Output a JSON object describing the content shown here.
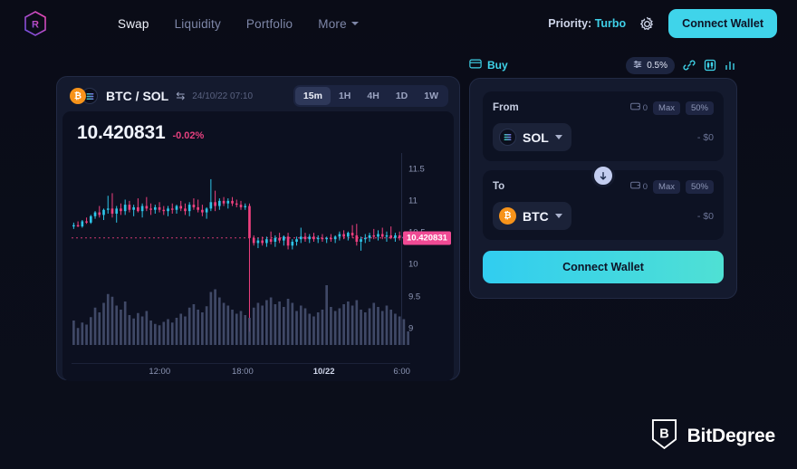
{
  "header": {
    "logo_icon": "raydium-hexagon-logo",
    "nav": [
      {
        "label": "Swap",
        "active": true
      },
      {
        "label": "Liquidity",
        "active": false
      },
      {
        "label": "Portfolio",
        "active": false
      },
      {
        "label": "More",
        "active": false,
        "has_chevron": true
      }
    ],
    "priority_label": "Priority:",
    "priority_value": "Turbo",
    "gear_icon": "gear-icon",
    "connect_wallet": "Connect Wallet",
    "accent_cyan": "#3fd4ea"
  },
  "chart_panel": {
    "base_icon": "btc-coin-icon",
    "quote_icon": "sol-coin-icon",
    "pair": "BTC / SOL",
    "swap_icon": "⇆",
    "timestamp": "24/10/22 07:10",
    "timeframes": [
      {
        "label": "15m",
        "active": true
      },
      {
        "label": "1H",
        "active": false
      },
      {
        "label": "4H",
        "active": false
      },
      {
        "label": "1D",
        "active": false
      },
      {
        "label": "1W",
        "active": false
      }
    ],
    "price": "10.420831",
    "change": "-0.02%",
    "change_color": "#e4407e",
    "price_badge": "10.420831"
  },
  "chart_data": {
    "type": "line",
    "subtype": "candlestick-with-volume",
    "title": "BTC / SOL",
    "xlabel": "",
    "ylabel": "",
    "ylim": [
      8.8,
      11.75
    ],
    "y_ticks": [
      "11.5",
      "11",
      "10.5",
      "10",
      "9.5",
      "9"
    ],
    "y_tick_values": [
      11.5,
      11,
      10.5,
      10,
      9.5,
      9
    ],
    "x_ticks": [
      {
        "label": "12:00",
        "pos": 0.26,
        "bold": false
      },
      {
        "label": "18:00",
        "pos": 0.505,
        "bold": false
      },
      {
        "label": "10/22",
        "pos": 0.745,
        "bold": true
      },
      {
        "label": "6:00",
        "pos": 0.975,
        "bold": false
      }
    ],
    "grid": false,
    "up_color": "#2ec5e8",
    "down_color": "#f0407f",
    "volume_color": "#4a5474",
    "current_price": 10.420831,
    "price_line_value": 10.42,
    "candles": [
      {
        "o": 10.6,
        "h": 10.66,
        "l": 10.56,
        "c": 10.62,
        "v": 0.36
      },
      {
        "o": 10.62,
        "h": 10.68,
        "l": 10.59,
        "c": 10.6,
        "v": 0.25
      },
      {
        "o": 10.6,
        "h": 10.7,
        "l": 10.58,
        "c": 10.68,
        "v": 0.33
      },
      {
        "o": 10.68,
        "h": 10.74,
        "l": 10.64,
        "c": 10.66,
        "v": 0.3
      },
      {
        "o": 10.66,
        "h": 10.78,
        "l": 10.64,
        "c": 10.76,
        "v": 0.41
      },
      {
        "o": 10.76,
        "h": 10.84,
        "l": 10.72,
        "c": 10.82,
        "v": 0.55
      },
      {
        "o": 10.82,
        "h": 10.92,
        "l": 10.74,
        "c": 10.78,
        "v": 0.48
      },
      {
        "o": 10.78,
        "h": 10.88,
        "l": 10.7,
        "c": 10.86,
        "v": 0.62
      },
      {
        "o": 10.86,
        "h": 11.08,
        "l": 10.8,
        "c": 10.88,
        "v": 0.75
      },
      {
        "o": 10.88,
        "h": 11.12,
        "l": 10.74,
        "c": 10.8,
        "v": 0.71
      },
      {
        "o": 10.8,
        "h": 10.92,
        "l": 10.66,
        "c": 10.88,
        "v": 0.58
      },
      {
        "o": 10.88,
        "h": 10.96,
        "l": 10.78,
        "c": 10.84,
        "v": 0.52
      },
      {
        "o": 10.84,
        "h": 11.02,
        "l": 10.78,
        "c": 10.94,
        "v": 0.64
      },
      {
        "o": 10.94,
        "h": 11.0,
        "l": 10.82,
        "c": 10.86,
        "v": 0.44
      },
      {
        "o": 10.86,
        "h": 10.94,
        "l": 10.76,
        "c": 10.9,
        "v": 0.39
      },
      {
        "o": 10.9,
        "h": 11.04,
        "l": 10.82,
        "c": 10.84,
        "v": 0.47
      },
      {
        "o": 10.84,
        "h": 10.96,
        "l": 10.74,
        "c": 10.92,
        "v": 0.42
      },
      {
        "o": 10.92,
        "h": 11.06,
        "l": 10.84,
        "c": 10.88,
        "v": 0.5
      },
      {
        "o": 10.88,
        "h": 10.96,
        "l": 10.78,
        "c": 10.86,
        "v": 0.36
      },
      {
        "o": 10.86,
        "h": 10.94,
        "l": 10.8,
        "c": 10.9,
        "v": 0.31
      },
      {
        "o": 10.9,
        "h": 10.98,
        "l": 10.82,
        "c": 10.86,
        "v": 0.29
      },
      {
        "o": 10.86,
        "h": 10.92,
        "l": 10.78,
        "c": 10.84,
        "v": 0.34
      },
      {
        "o": 10.84,
        "h": 10.92,
        "l": 10.76,
        "c": 10.88,
        "v": 0.38
      },
      {
        "o": 10.88,
        "h": 10.96,
        "l": 10.8,
        "c": 10.86,
        "v": 0.33
      },
      {
        "o": 10.86,
        "h": 10.94,
        "l": 10.8,
        "c": 10.92,
        "v": 0.4
      },
      {
        "o": 10.92,
        "h": 11.0,
        "l": 10.84,
        "c": 10.88,
        "v": 0.46
      },
      {
        "o": 10.88,
        "h": 10.96,
        "l": 10.78,
        "c": 10.84,
        "v": 0.42
      },
      {
        "o": 10.84,
        "h": 10.98,
        "l": 10.76,
        "c": 10.94,
        "v": 0.55
      },
      {
        "o": 10.94,
        "h": 11.04,
        "l": 10.86,
        "c": 10.9,
        "v": 0.6
      },
      {
        "o": 10.9,
        "h": 11.02,
        "l": 10.82,
        "c": 10.86,
        "v": 0.52
      },
      {
        "o": 10.86,
        "h": 10.94,
        "l": 10.76,
        "c": 10.82,
        "v": 0.48
      },
      {
        "o": 10.82,
        "h": 10.9,
        "l": 10.72,
        "c": 10.88,
        "v": 0.57
      },
      {
        "o": 10.88,
        "h": 11.34,
        "l": 10.84,
        "c": 10.98,
        "v": 0.78
      },
      {
        "o": 10.98,
        "h": 11.16,
        "l": 10.84,
        "c": 10.92,
        "v": 0.82
      },
      {
        "o": 10.92,
        "h": 11.04,
        "l": 10.86,
        "c": 11.0,
        "v": 0.7
      },
      {
        "o": 11.0,
        "h": 11.06,
        "l": 10.92,
        "c": 10.96,
        "v": 0.62
      },
      {
        "o": 10.96,
        "h": 11.04,
        "l": 10.88,
        "c": 11.0,
        "v": 0.58
      },
      {
        "o": 11.0,
        "h": 11.06,
        "l": 10.92,
        "c": 10.96,
        "v": 0.52
      },
      {
        "o": 10.96,
        "h": 11.02,
        "l": 10.9,
        "c": 10.94,
        "v": 0.46
      },
      {
        "o": 10.94,
        "h": 11.0,
        "l": 10.86,
        "c": 10.9,
        "v": 0.5
      },
      {
        "o": 10.9,
        "h": 10.96,
        "l": 10.86,
        "c": 10.92,
        "v": 0.44
      },
      {
        "o": 10.92,
        "h": 10.96,
        "l": 8.95,
        "c": 10.42,
        "v": 0.4
      },
      {
        "o": 10.42,
        "h": 10.46,
        "l": 10.3,
        "c": 10.34,
        "v": 0.55
      },
      {
        "o": 10.34,
        "h": 10.42,
        "l": 10.26,
        "c": 10.38,
        "v": 0.62
      },
      {
        "o": 10.38,
        "h": 10.44,
        "l": 10.3,
        "c": 10.34,
        "v": 0.58
      },
      {
        "o": 10.34,
        "h": 10.44,
        "l": 10.28,
        "c": 10.4,
        "v": 0.66
      },
      {
        "o": 10.4,
        "h": 10.52,
        "l": 10.32,
        "c": 10.36,
        "v": 0.7
      },
      {
        "o": 10.36,
        "h": 10.46,
        "l": 10.28,
        "c": 10.42,
        "v": 0.6
      },
      {
        "o": 10.42,
        "h": 10.5,
        "l": 10.34,
        "c": 10.38,
        "v": 0.64
      },
      {
        "o": 10.38,
        "h": 10.46,
        "l": 10.3,
        "c": 10.44,
        "v": 0.56
      },
      {
        "o": 10.44,
        "h": 10.5,
        "l": 10.24,
        "c": 10.3,
        "v": 0.68
      },
      {
        "o": 10.3,
        "h": 10.4,
        "l": 10.24,
        "c": 10.36,
        "v": 0.62
      },
      {
        "o": 10.36,
        "h": 10.44,
        "l": 10.3,
        "c": 10.4,
        "v": 0.5
      },
      {
        "o": 10.4,
        "h": 10.58,
        "l": 10.34,
        "c": 10.44,
        "v": 0.58
      },
      {
        "o": 10.44,
        "h": 10.5,
        "l": 10.36,
        "c": 10.4,
        "v": 0.54
      },
      {
        "o": 10.4,
        "h": 10.48,
        "l": 10.34,
        "c": 10.44,
        "v": 0.46
      },
      {
        "o": 10.44,
        "h": 10.5,
        "l": 10.36,
        "c": 10.4,
        "v": 0.42
      },
      {
        "o": 10.4,
        "h": 10.46,
        "l": 10.34,
        "c": 10.42,
        "v": 0.48
      },
      {
        "o": 10.42,
        "h": 10.48,
        "l": 10.36,
        "c": 10.4,
        "v": 0.52
      },
      {
        "o": 10.4,
        "h": 10.44,
        "l": 10.34,
        "c": 10.42,
        "v": 0.88
      },
      {
        "o": 10.42,
        "h": 10.48,
        "l": 10.36,
        "c": 10.4,
        "v": 0.56
      },
      {
        "o": 10.4,
        "h": 10.46,
        "l": 10.34,
        "c": 10.44,
        "v": 0.5
      },
      {
        "o": 10.44,
        "h": 10.52,
        "l": 10.38,
        "c": 10.48,
        "v": 0.54
      },
      {
        "o": 10.48,
        "h": 10.54,
        "l": 10.4,
        "c": 10.44,
        "v": 0.6
      },
      {
        "o": 10.44,
        "h": 10.52,
        "l": 10.38,
        "c": 10.5,
        "v": 0.64
      },
      {
        "o": 10.5,
        "h": 10.62,
        "l": 10.42,
        "c": 10.46,
        "v": 0.58
      },
      {
        "o": 10.46,
        "h": 10.64,
        "l": 10.3,
        "c": 10.36,
        "v": 0.66
      },
      {
        "o": 10.36,
        "h": 10.44,
        "l": 10.22,
        "c": 10.4,
        "v": 0.52
      },
      {
        "o": 10.4,
        "h": 10.48,
        "l": 10.34,
        "c": 10.42,
        "v": 0.48
      },
      {
        "o": 10.42,
        "h": 10.5,
        "l": 10.36,
        "c": 10.46,
        "v": 0.54
      },
      {
        "o": 10.46,
        "h": 10.56,
        "l": 10.4,
        "c": 10.44,
        "v": 0.62
      },
      {
        "o": 10.44,
        "h": 10.54,
        "l": 10.38,
        "c": 10.48,
        "v": 0.56
      },
      {
        "o": 10.48,
        "h": 10.58,
        "l": 10.4,
        "c": 10.44,
        "v": 0.5
      },
      {
        "o": 10.44,
        "h": 10.52,
        "l": 10.36,
        "c": 10.46,
        "v": 0.58
      },
      {
        "o": 10.46,
        "h": 10.6,
        "l": 10.4,
        "c": 10.42,
        "v": 0.52
      },
      {
        "o": 10.42,
        "h": 10.5,
        "l": 10.36,
        "c": 10.46,
        "v": 0.46
      },
      {
        "o": 10.46,
        "h": 10.52,
        "l": 10.38,
        "c": 10.42,
        "v": 0.42
      },
      {
        "o": 10.42,
        "h": 10.48,
        "l": 10.36,
        "c": 10.44,
        "v": 0.38
      },
      {
        "o": 10.44,
        "h": 10.5,
        "l": 10.38,
        "c": 10.42,
        "v": 0.2
      }
    ]
  },
  "swap_panel": {
    "tab_icon": "card-icon",
    "tab_label": "Buy",
    "slippage_icon": "sliders-icon",
    "slippage": "0.5%",
    "tools": [
      "link-icon",
      "candlestick-chart-icon",
      "bar-chart-icon"
    ],
    "from": {
      "label": "From",
      "wallet_icon": "wallet-icon",
      "balance": "0",
      "max_label": "Max",
      "half_label": "50%",
      "token": "SOL",
      "token_icon": "sol-coin-icon",
      "usd": "- $0"
    },
    "swap_arrow_icon": "arrow-down-icon",
    "to": {
      "label": "To",
      "wallet_icon": "wallet-icon",
      "balance": "0",
      "max_label": "Max",
      "half_label": "50%",
      "token": "BTC",
      "token_icon": "btc-coin-icon",
      "usd": "- $0"
    },
    "cta": "Connect Wallet"
  },
  "watermark": {
    "text": "BitDegree",
    "icon": "bitdegree-shield-logo"
  }
}
